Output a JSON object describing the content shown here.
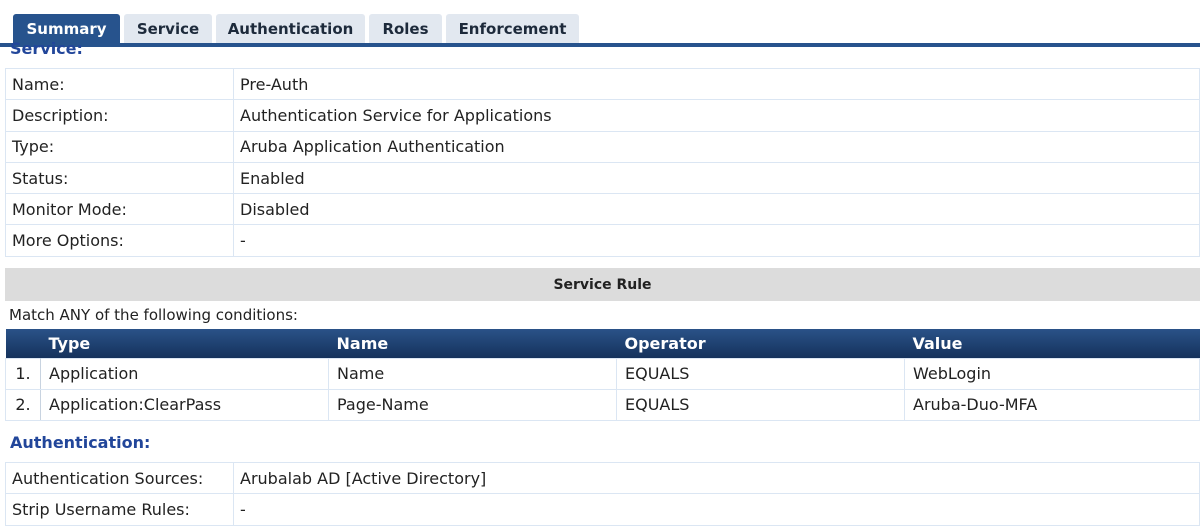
{
  "tabs": [
    {
      "label": "Summary",
      "active": true
    },
    {
      "label": "Service",
      "active": false
    },
    {
      "label": "Authentication",
      "active": false
    },
    {
      "label": "Roles",
      "active": false
    },
    {
      "label": "Enforcement",
      "active": false
    }
  ],
  "service": {
    "title": "Service:",
    "rows": [
      {
        "key": "Name:",
        "value": "Pre-Auth"
      },
      {
        "key": "Description:",
        "value": "Authentication Service for Applications"
      },
      {
        "key": "Type:",
        "value": "Aruba Application Authentication"
      },
      {
        "key": "Status:",
        "value": "Enabled"
      },
      {
        "key": "Monitor Mode:",
        "value": "Disabled"
      },
      {
        "key": "More Options:",
        "value": "-"
      }
    ]
  },
  "service_rule": {
    "header": "Service Rule",
    "match_text": "Match ANY of the following conditions:",
    "columns": [
      "Type",
      "Name",
      "Operator",
      "Value"
    ],
    "rows": [
      {
        "num": "1.",
        "type": "Application",
        "name": "Name",
        "operator": "EQUALS",
        "value": "WebLogin"
      },
      {
        "num": "2.",
        "type": "Application:ClearPass",
        "name": "Page-Name",
        "operator": "EQUALS",
        "value": "Aruba-Duo-MFA"
      }
    ]
  },
  "authentication": {
    "title": "Authentication:",
    "rows": [
      {
        "key": "Authentication Sources:",
        "value": "Arubalab AD [Active Directory]"
      },
      {
        "key": "Strip Username Rules:",
        "value": "-"
      }
    ]
  },
  "colors": {
    "accent": "#27538d",
    "section_title": "#22469a",
    "tab_inactive": "#e2e8f0",
    "grid_header": "#1d3f6e",
    "rule_header_bg": "#dcdcdc"
  }
}
